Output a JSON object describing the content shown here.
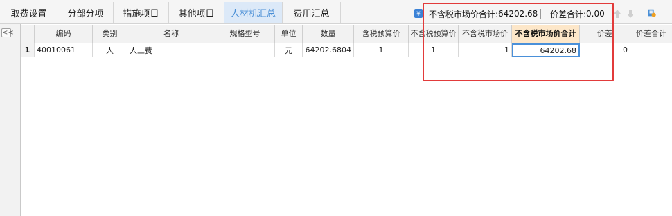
{
  "tabs": [
    {
      "label": "取费设置"
    },
    {
      "label": "分部分项"
    },
    {
      "label": "措施项目"
    },
    {
      "label": "其他项目"
    },
    {
      "label": "人材机汇总"
    },
    {
      "label": "费用汇总"
    }
  ],
  "active_tab": "人材机汇总",
  "toolbar": {
    "tax_excl_market_total_label": "不含税市场价合计:",
    "tax_excl_market_total_value": "64202.68",
    "price_diff_total_label": "价差合计:",
    "price_diff_total_value": "0.00"
  },
  "left_strip": {
    "collapse_label": "<<"
  },
  "table": {
    "columns": [
      {
        "label": ""
      },
      {
        "label": "编码"
      },
      {
        "label": "类别"
      },
      {
        "label": "名称"
      },
      {
        "label": "规格型号"
      },
      {
        "label": "单位"
      },
      {
        "label": "数量"
      },
      {
        "label": "含税预算价"
      },
      {
        "label": "不含税预算价"
      },
      {
        "label": "不含税市场价"
      },
      {
        "label": "不含税市场价合计"
      },
      {
        "label": "价差"
      },
      {
        "label": "价差合计"
      }
    ],
    "rows": [
      {
        "row_no": "1",
        "code": "40010061",
        "category": "人",
        "name": "人工费",
        "spec": "",
        "unit": "元",
        "quantity": "64202.6804",
        "tax_incl_budget_price": "1",
        "tax_excl_budget_price": "1",
        "tax_excl_market_price": "1",
        "tax_excl_market_total": "64202.68",
        "price_diff": "0",
        "price_diff_total": ""
      }
    ]
  },
  "colors": {
    "active_tab_bg": "#dce9f8",
    "active_tab_text": "#4a8fd6",
    "highlight_header_bg": "#fde7c9",
    "annotation_box": "#e23b3b",
    "selection_border": "#4a90d9"
  }
}
